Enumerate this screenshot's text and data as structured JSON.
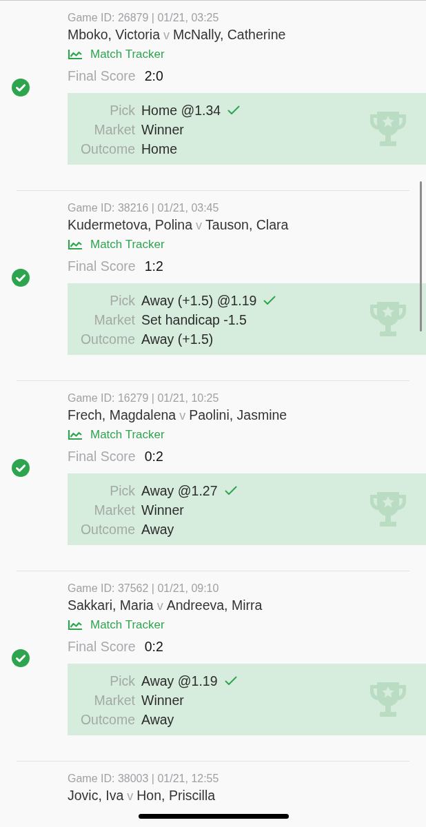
{
  "bets": [
    {
      "won": true,
      "game_id": "Game ID: 26879 | 01/21, 03:25",
      "home": "Mboko, Victoria",
      "vs": "v",
      "away": "McNally, Catherine",
      "tracker": "Match Tracker",
      "score_label": "Final Score",
      "score": "2:0",
      "details": [
        {
          "label": "Pick",
          "value": "Home @1.34"
        },
        {
          "label": "Market",
          "value": "Winner"
        },
        {
          "label": "Outcome",
          "value": "Home"
        }
      ]
    },
    {
      "won": true,
      "game_id": "Game ID: 38216 | 01/21, 03:45",
      "home": "Kudermetova, Polina",
      "vs": "v",
      "away": "Tauson, Clara",
      "tracker": "Match Tracker",
      "score_label": "Final Score",
      "score": "1:2",
      "details": [
        {
          "label": "Pick",
          "value": "Away (+1.5) @1.19"
        },
        {
          "label": "Market",
          "value": "Set handicap -1.5"
        },
        {
          "label": "Outcome",
          "value": "Away (+1.5)"
        }
      ]
    },
    {
      "won": true,
      "game_id": "Game ID: 16279 | 01/21, 10:25",
      "home": "Frech, Magdalena",
      "vs": "v",
      "away": "Paolini, Jasmine",
      "tracker": "Match Tracker",
      "score_label": "Final Score",
      "score": "0:2",
      "details": [
        {
          "label": "Pick",
          "value": "Away @1.27"
        },
        {
          "label": "Market",
          "value": "Winner"
        },
        {
          "label": "Outcome",
          "value": "Away"
        }
      ]
    },
    {
      "won": true,
      "game_id": "Game ID: 37562 | 01/21, 09:10",
      "home": "Sakkari, Maria",
      "vs": "v",
      "away": "Andreeva, Mirra",
      "tracker": "Match Tracker",
      "score_label": "Final Score",
      "score": "0:2",
      "details": [
        {
          "label": "Pick",
          "value": "Away @1.19"
        },
        {
          "label": "Market",
          "value": "Winner"
        },
        {
          "label": "Outcome",
          "value": "Away"
        }
      ]
    },
    {
      "game_id": "Game ID: 38003 | 01/21, 12:55",
      "home": "Jovic, Iva",
      "vs": "v",
      "away": "Hon, Priscilla"
    }
  ]
}
